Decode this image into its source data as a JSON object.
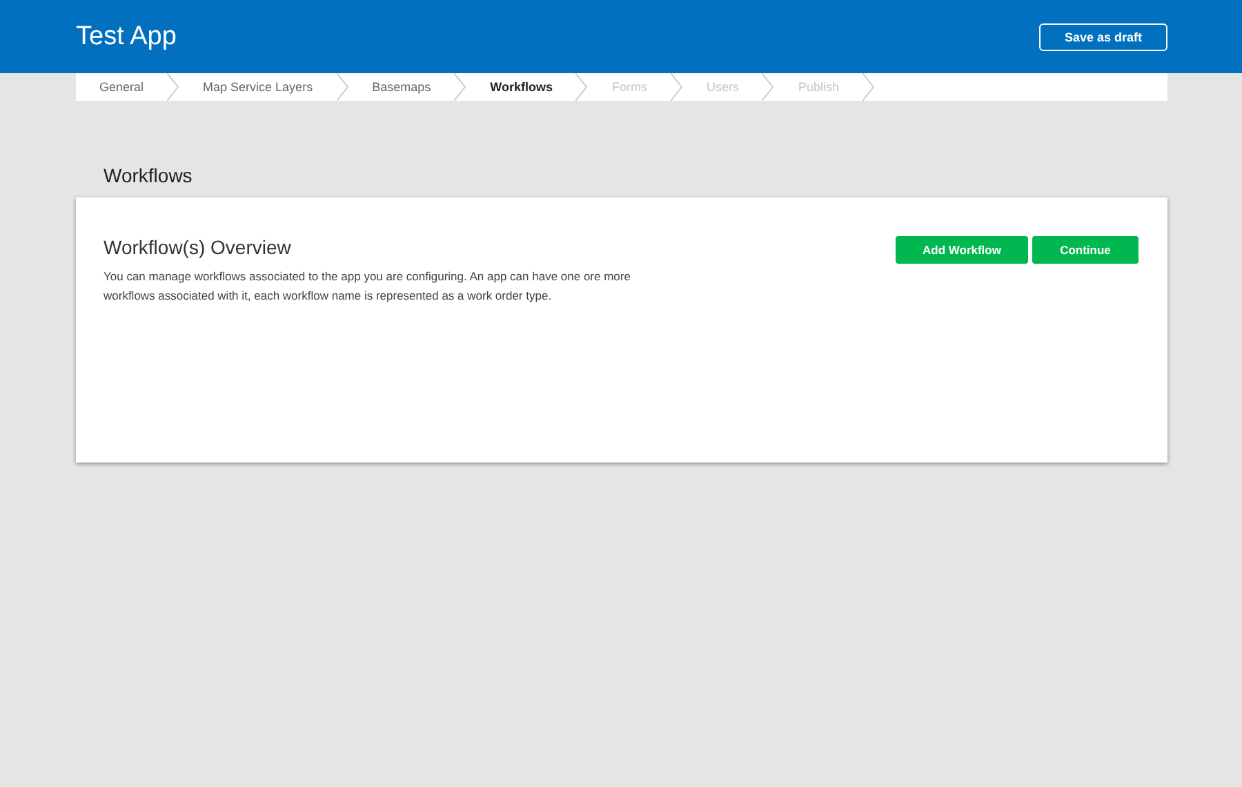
{
  "header": {
    "title": "Test App",
    "save_button": "Save as draft"
  },
  "steps": [
    {
      "label": "General",
      "selected": false,
      "disabled": false
    },
    {
      "label": "Map Service Layers",
      "selected": false,
      "disabled": false
    },
    {
      "label": "Basemaps",
      "selected": false,
      "disabled": false
    },
    {
      "label": "Workflows",
      "selected": true,
      "disabled": false
    },
    {
      "label": "Forms",
      "selected": false,
      "disabled": true
    },
    {
      "label": "Users",
      "selected": false,
      "disabled": true
    },
    {
      "label": "Publish",
      "selected": false,
      "disabled": true
    }
  ],
  "section_title": "Workflows",
  "card": {
    "title": "Workflow(s) Overview",
    "description": "You can manage workflows associated to the app you are configuring. An app can have one ore more workflows associated with it, each workflow name is represented as a work order type.",
    "buttons": [
      "Add Workflow",
      "Continue"
    ]
  }
}
